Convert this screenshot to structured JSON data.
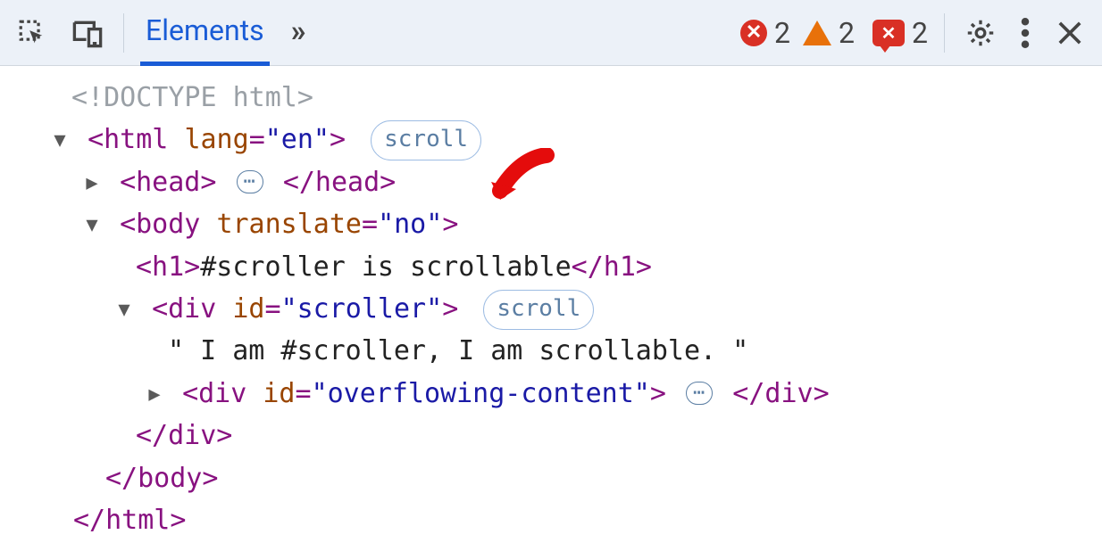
{
  "toolbar": {
    "tab_elements": "Elements",
    "more_glyph": "»",
    "errors_count": "2",
    "warnings_count": "2",
    "issues_count": "2",
    "error_x": "✕",
    "issue_x": "✕"
  },
  "badges": {
    "scroll": "scroll"
  },
  "dom": {
    "doctype": "<!DOCTYPE html>",
    "html_open_pre": "<html",
    "html_lang_attr": "lang",
    "html_lang_val": "\"en\"",
    "html_open_post": ">",
    "head_open": "<head>",
    "head_close": "</head>",
    "body_open_pre": "<body",
    "body_translate_attr": "translate",
    "body_translate_val": "\"no\"",
    "body_open_post": ">",
    "h1_open": "<h1>",
    "h1_text": "#scroller is scrollable",
    "h1_close": "</h1>",
    "div1_open_pre": "<div",
    "div1_id_attr": "id",
    "div1_id_val": "\"scroller\"",
    "div1_open_post": ">",
    "scroller_text": "\" I am #scroller, I am scrollable. \"",
    "div2_open_pre": "<div",
    "div2_id_attr": "id",
    "div2_id_val": "\"overflowing-content\"",
    "div2_open_post": ">",
    "div_close": "</div>",
    "body_close": "</body>",
    "html_close": "</html>",
    "ellipsis": "⋯"
  }
}
